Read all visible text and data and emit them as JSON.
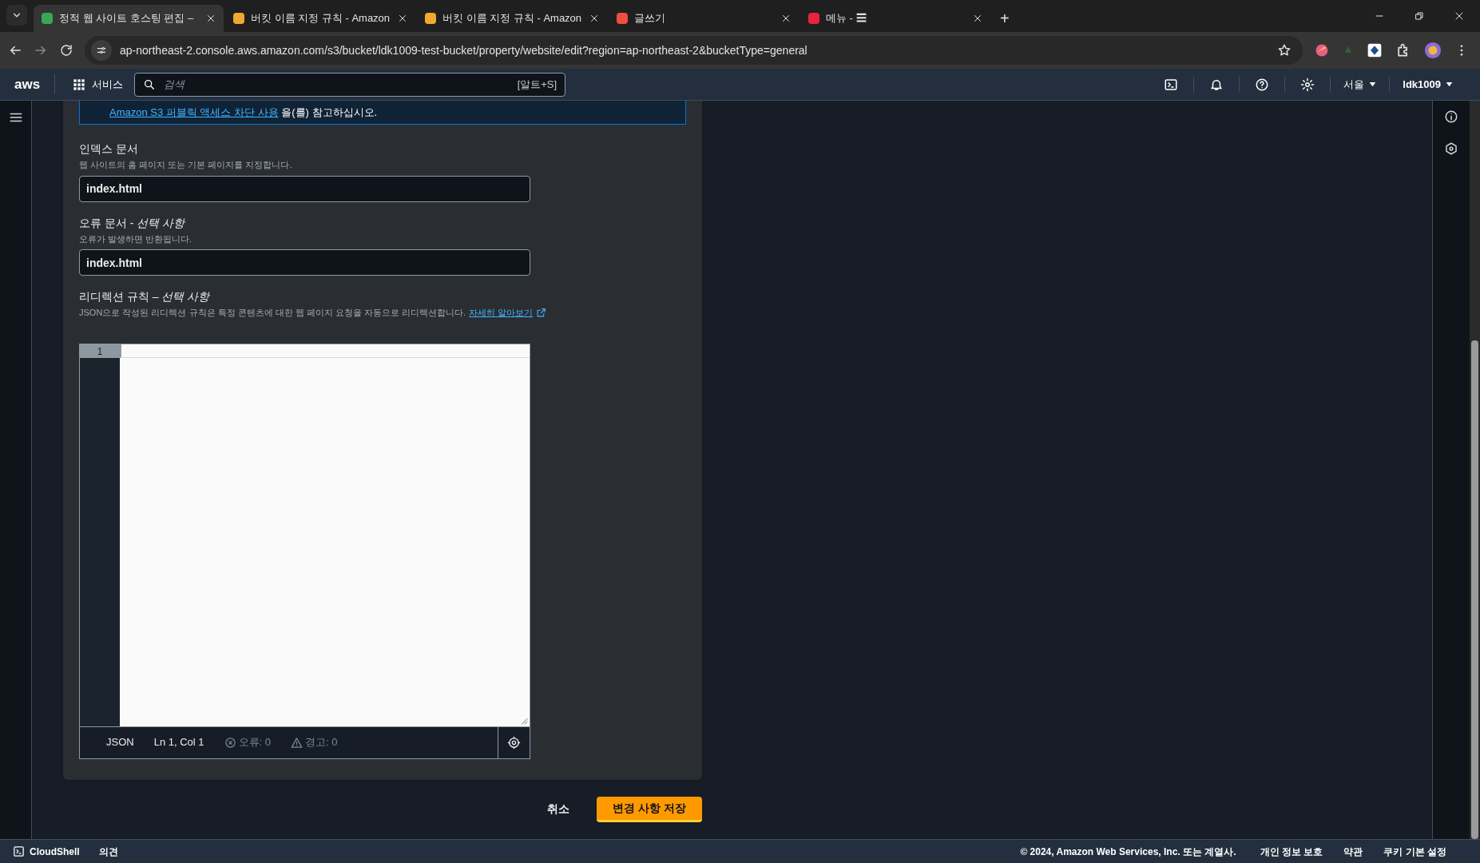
{
  "browser": {
    "tabs": [
      {
        "title": "정적 웹 사이트 호스팅 편집 –",
        "selected": true,
        "color": "#3aa655"
      },
      {
        "title": "버킷 이름 지정 규칙 - Amazon",
        "selected": false,
        "color": "#f0a830"
      },
      {
        "title": "버킷 이름 지정 규칙 - Amazon",
        "selected": false,
        "color": "#f0a830"
      },
      {
        "title": "글쓰기",
        "selected": false,
        "color": "#f04e3e"
      },
      {
        "title": "메뉴 - ☰",
        "selected": false,
        "color": "#e8233f"
      }
    ],
    "new_tab": "+",
    "url": "ap-northeast-2.console.aws.amazon.com/s3/bucket/ldk1009-test-bucket/property/website/edit?region=ap-northeast-2&bucketType=general"
  },
  "header": {
    "logo": "aws",
    "services": "서비스",
    "search": {
      "placeholder": "검색",
      "shortcut": "[알트+S]"
    },
    "region": "서울",
    "account": "ldk1009"
  },
  "info_box": {
    "link": "Amazon S3 퍼블릭 액세스 차단 사용",
    "text": "을(를) 참고하십시오."
  },
  "fields": [
    {
      "label": "인덱스 문서",
      "description": "웹 사이트의 홈 페이지 또는 기본 페이지를 지정합니다.",
      "value": "index.html"
    },
    {
      "label": "오류 문서 - ",
      "optional": "선택 사항",
      "description": "오류가 발생하면 반환됩니다.",
      "value": "index.html"
    }
  ],
  "redirect": {
    "label": "리디렉션 규칙 – ",
    "optional": "선택 사항",
    "description": "JSON으로 작성된 리디렉션 규칙은 특정 콘텐츠에 대한 웹 페이지 요청을 자동으로 리디렉션합니다.",
    "link": "자세히 알아보기"
  },
  "editor": {
    "line_numbers": [
      "1"
    ],
    "language": "JSON",
    "position": "Ln 1, Col 1",
    "errors": "오류: 0",
    "warnings": "경고: 0"
  },
  "actions": {
    "cancel": "취소",
    "save": "변경 사항 저장"
  },
  "footer": {
    "cloudshell": "CloudShell",
    "feedback": "의견",
    "copyright": "© 2024, Amazon Web Services, Inc. 또는 계열사.",
    "links": [
      "개인 정보 보호",
      "약관",
      "쿠키 기본 설정"
    ]
  }
}
